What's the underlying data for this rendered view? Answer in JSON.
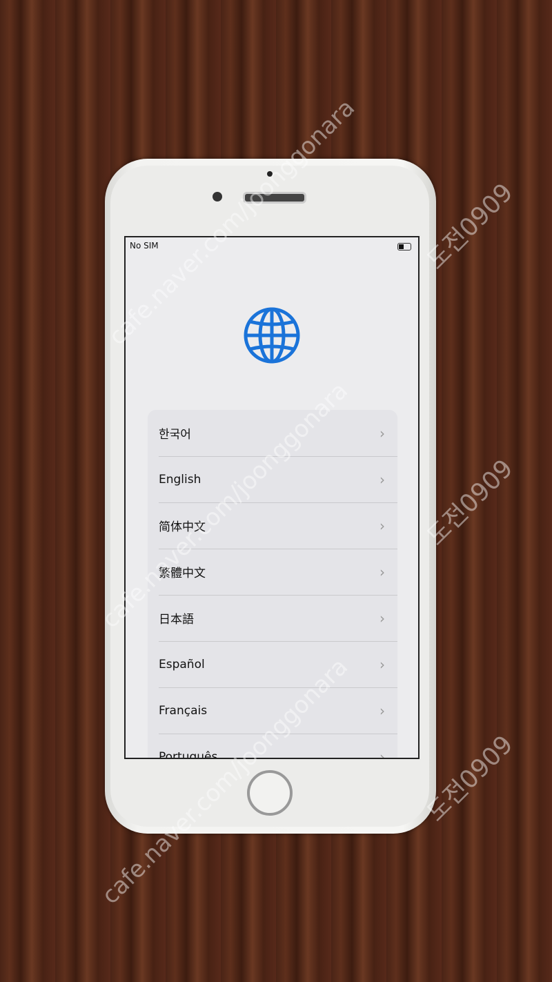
{
  "status": {
    "carrier": "No SIM",
    "battery_level": 0.4
  },
  "icon": "globe-icon",
  "accent": "#1a73d9",
  "languages": [
    {
      "label": "한국어"
    },
    {
      "label": "English"
    },
    {
      "label": "简体中文"
    },
    {
      "label": "繁體中文"
    },
    {
      "label": "日本語"
    },
    {
      "label": "Español"
    },
    {
      "label": "Français"
    },
    {
      "label": "Português"
    }
  ],
  "watermarks": {
    "url": "cafe.naver.com/joonggonara",
    "tag": "도전0909"
  }
}
